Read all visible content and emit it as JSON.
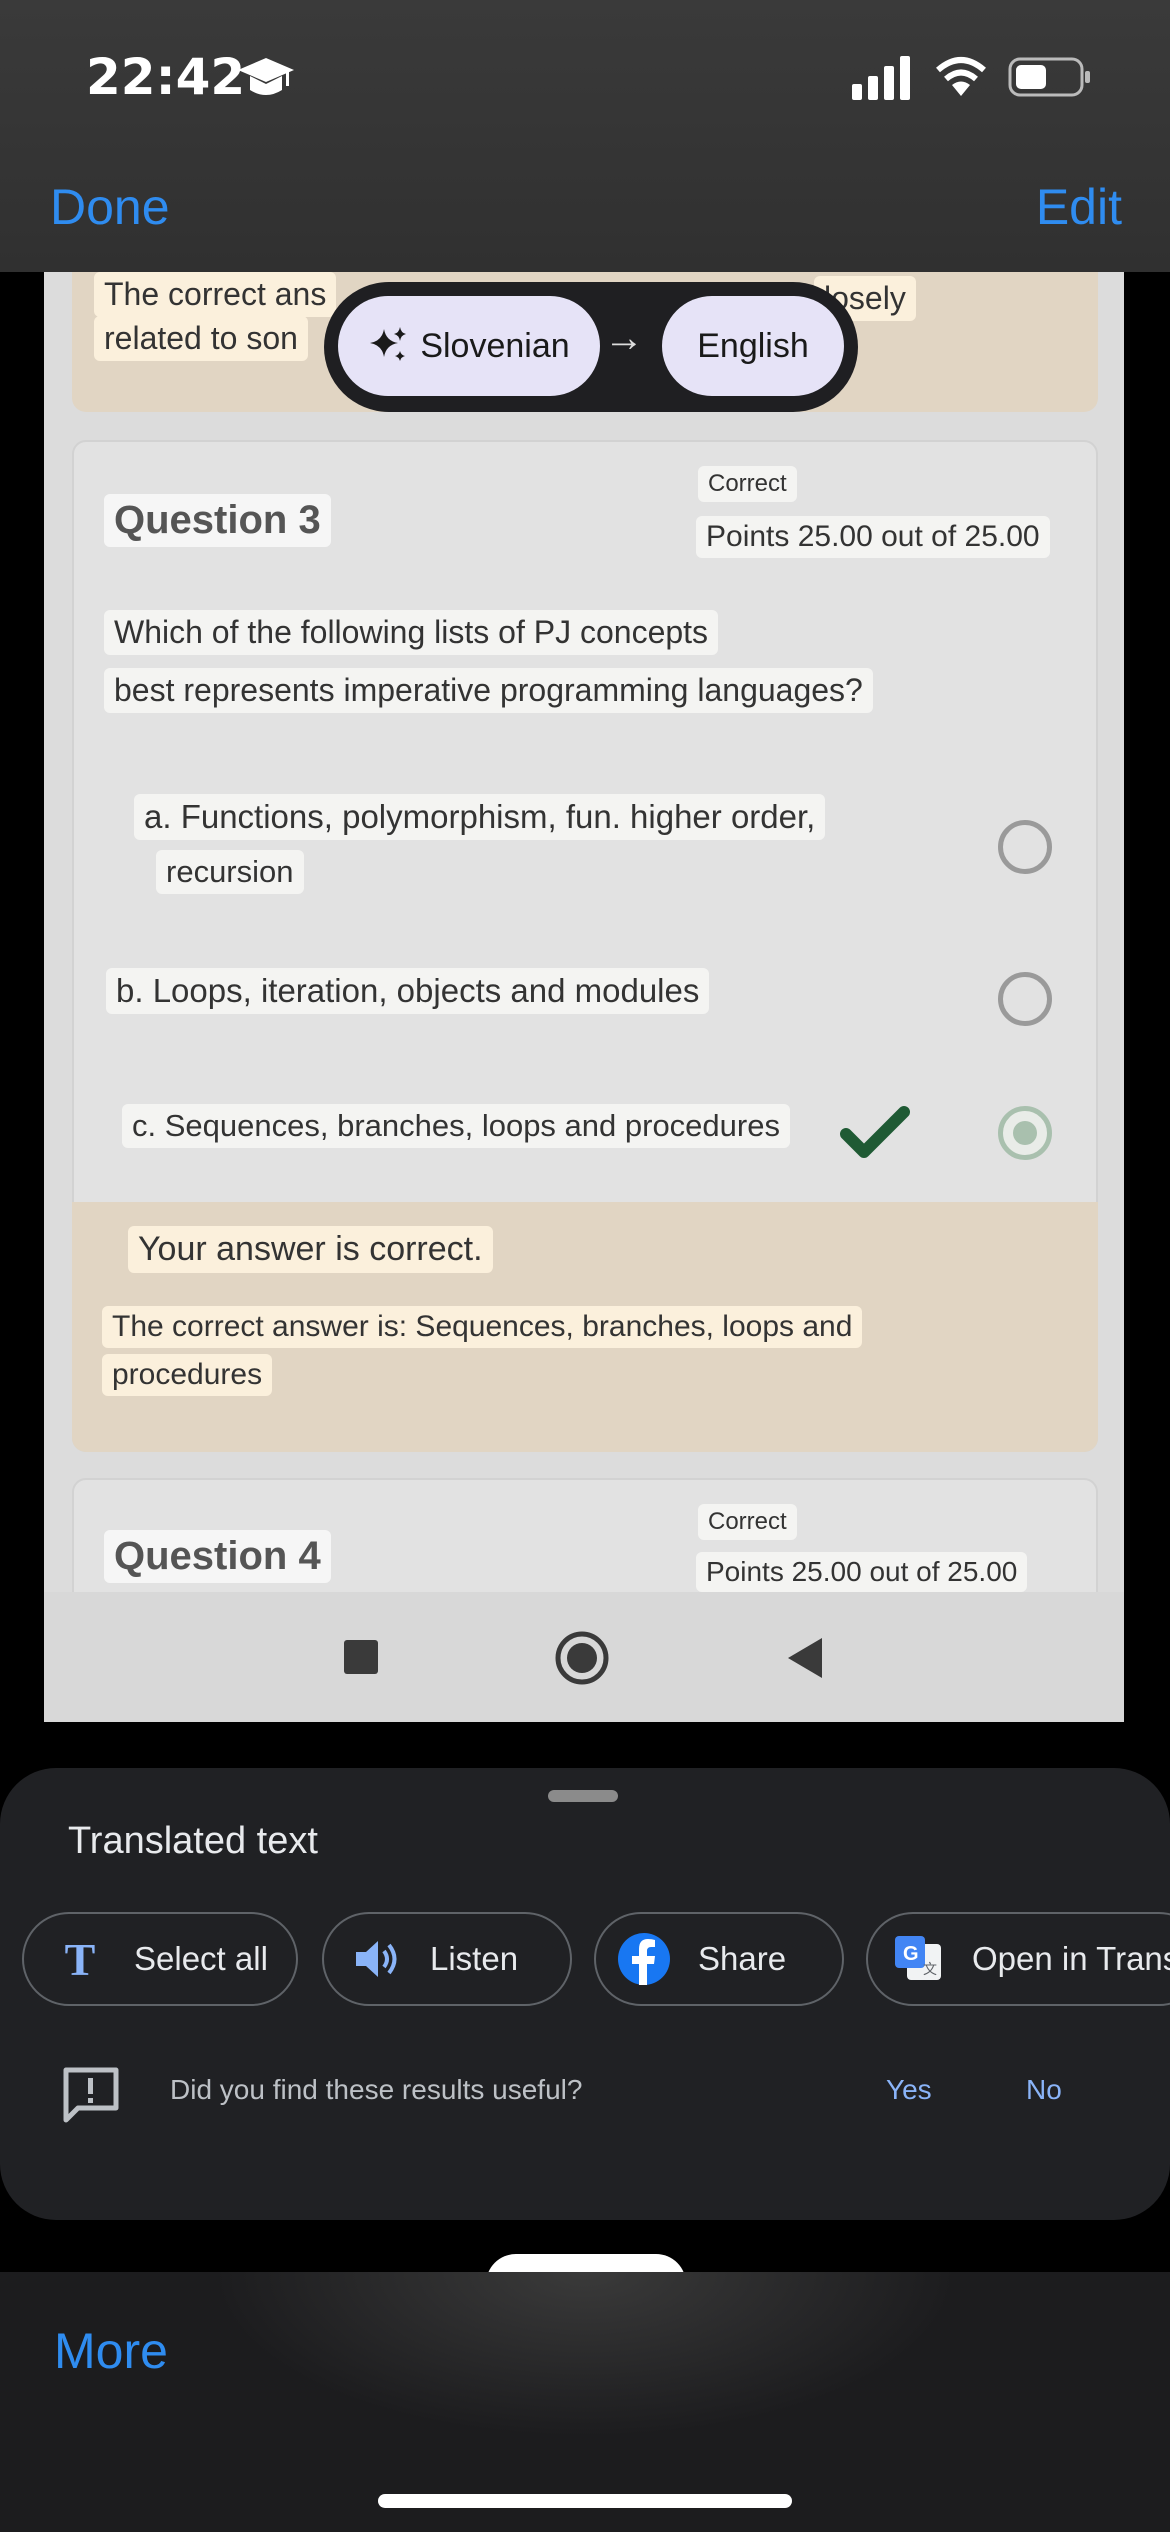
{
  "status_bar": {
    "time": "22:42"
  },
  "nav": {
    "done": "Done",
    "edit": "Edit",
    "more": "More"
  },
  "languages": {
    "source": "Slovenian",
    "arrow": "→",
    "target": "English"
  },
  "prev_feedback": {
    "line1": "The correct ans",
    "line1_tail": "losely",
    "line2": "related to son"
  },
  "question3": {
    "title": "Question 3",
    "status": "Correct",
    "points": "Points 25.00 out of 25.00",
    "prompt_line1": "Which of the following lists of PJ concepts",
    "prompt_line2": "best represents imperative programming languages?",
    "options": [
      {
        "line1": "a. Functions, polymorphism, fun. higher order,",
        "line2": "recursion",
        "selected": false
      },
      {
        "line1": "b. Loops, iteration, objects and modules",
        "selected": false
      },
      {
        "line1": "c. Sequences, branches, loops and procedures",
        "selected": true,
        "correct": true
      }
    ],
    "feedback_title": "Your answer is correct.",
    "feedback_line1": "The correct answer is: Sequences, branches, loops and",
    "feedback_line2": "procedures"
  },
  "question4": {
    "title": "Question 4",
    "status": "Correct",
    "points": "Points 25.00 out of 25.00"
  },
  "sheet": {
    "title": "Translated text",
    "actions": {
      "select_all": "Select all",
      "listen": "Listen",
      "share": "Share",
      "open": "Open in Trans"
    },
    "feedback_prompt": "Did you find these results useful?",
    "yes": "Yes",
    "no": "No"
  },
  "colors": {
    "ios_blue": "#2f8cf0",
    "google_blue": "#8ab4f8",
    "chip_lavender": "#e6e3f7",
    "check_green": "#1f5a34"
  }
}
